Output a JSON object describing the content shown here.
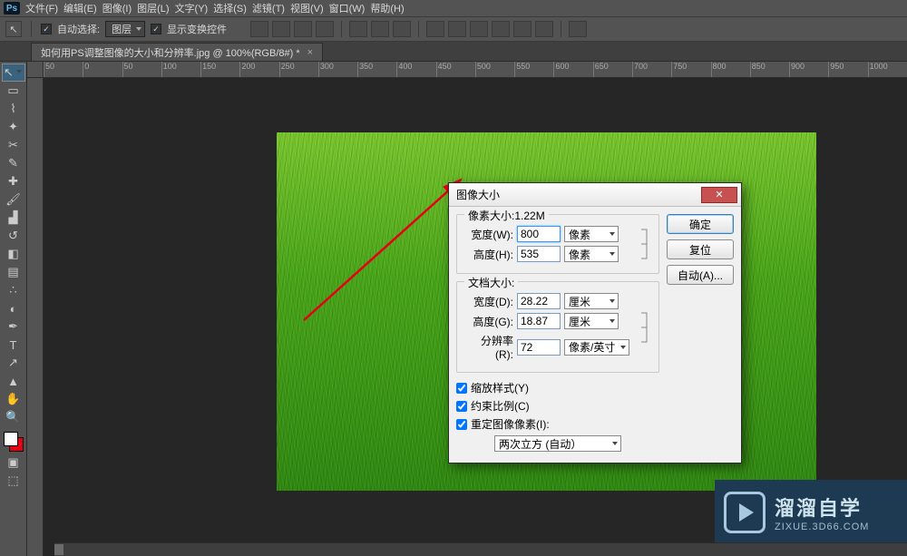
{
  "menu": {
    "items": [
      "文件(F)",
      "编辑(E)",
      "图像(I)",
      "图层(L)",
      "文字(Y)",
      "选择(S)",
      "滤镜(T)",
      "视图(V)",
      "窗口(W)",
      "帮助(H)"
    ]
  },
  "optbar": {
    "auto_select_label": "自动选择:",
    "auto_select_value": "图层",
    "show_transform": "显示变换控件"
  },
  "doctab": {
    "title": "如何用PS调整图像的大小和分辨率.jpg @ 100%(RGB/8#) *"
  },
  "ruler_marks": [
    "50",
    "0",
    "50",
    "100",
    "150",
    "200",
    "250",
    "300",
    "350",
    "400",
    "450",
    "500",
    "550",
    "600",
    "650",
    "700",
    "750",
    "800",
    "850",
    "900",
    "950",
    "1000"
  ],
  "dialog": {
    "title": "图像大小",
    "pixel_dim_legend": "像素大小:1.22M",
    "width_label": "宽度(W):",
    "width_value": "800",
    "height_label": "高度(H):",
    "height_value": "535",
    "unit_px": "像素",
    "doc_dim_legend": "文档大小:",
    "dwidth_label": "宽度(D):",
    "dwidth_value": "28.22",
    "dheight_label": "高度(G):",
    "dheight_value": "18.87",
    "unit_cm": "厘米",
    "res_label": "分辨率(R):",
    "res_value": "72",
    "unit_res": "像素/英寸",
    "scale_styles": "缩放样式(Y)",
    "constrain": "约束比例(C)",
    "resample": "重定图像像素(I):",
    "resample_method": "两次立方 (自动）",
    "ok": "确定",
    "cancel": "复位",
    "auto": "自动(A)..."
  },
  "watermark": {
    "big": "溜溜自学",
    "small": "ZIXUE.3D66.COM"
  },
  "tools": [
    "move",
    "marquee",
    "lasso",
    "wand",
    "crop",
    "eyedrop",
    "heal",
    "brush",
    "stamp",
    "history",
    "eraser",
    "gradient",
    "blur",
    "dodge",
    "pen",
    "type",
    "path",
    "shape",
    "hand",
    "zoom"
  ],
  "tool_glyphs": [
    "↖",
    "▭",
    "⌇",
    "✦",
    "✂",
    "✎",
    "✚",
    "🖌",
    "▟",
    "↺",
    "◧",
    "▤",
    "∴",
    "◐",
    "✒",
    "T",
    "↗",
    "▲",
    "✋",
    "🔍"
  ]
}
